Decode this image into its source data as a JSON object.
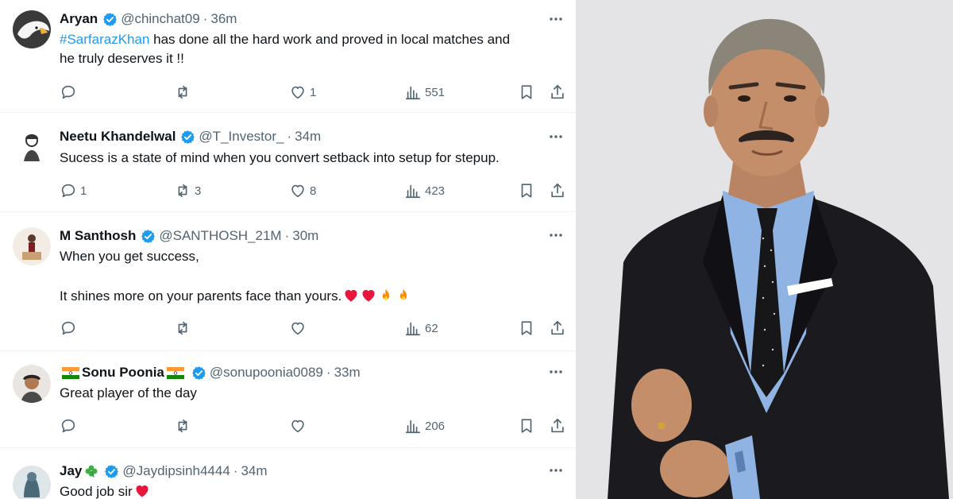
{
  "tweets": [
    {
      "name": "Aryan",
      "handle": "@chinchat09",
      "time": "36m",
      "hashtag": "#SarfarazKhan",
      "line1_rest": " has done all the hard work and proved in local matches and",
      "line2": "he truly deserves it !!",
      "replies": "",
      "retweets": "",
      "likes": "1",
      "views": "551"
    },
    {
      "name": "Neetu Khandelwal",
      "handle": "@T_Investor_",
      "time": "34m",
      "line1": "Sucess is a state of mind when you convert setback into setup for stepup.",
      "replies": "1",
      "retweets": "3",
      "likes": "8",
      "views": "423"
    },
    {
      "name": "M Santhosh",
      "handle": "@SANTHOSH_21M",
      "time": "30m",
      "line1": "When you get success,",
      "line2": "It shines more on your parents face than yours.",
      "replies": "",
      "retweets": "",
      "likes": "",
      "views": "62"
    },
    {
      "name": "Sonu Poonia",
      "handle": "@sonupoonia0089",
      "time": "33m",
      "line1": "Great player of the day",
      "replies": "",
      "retweets": "",
      "likes": "",
      "views": "206"
    },
    {
      "name": "Jay",
      "handle": "@Jaydipsinh4444",
      "time": "34m",
      "line1": "Good job sir"
    }
  ],
  "colors": {
    "accent": "#1d9bf0",
    "muted": "#536471",
    "heart": "#e8163a"
  },
  "icons": [
    "verified-badge-icon",
    "more-icon",
    "reply-icon",
    "retweet-icon",
    "like-icon",
    "views-icon",
    "bookmark-icon",
    "share-icon",
    "heart-emoji",
    "fire-emoji",
    "india-flag",
    "shamrock-emoji"
  ]
}
